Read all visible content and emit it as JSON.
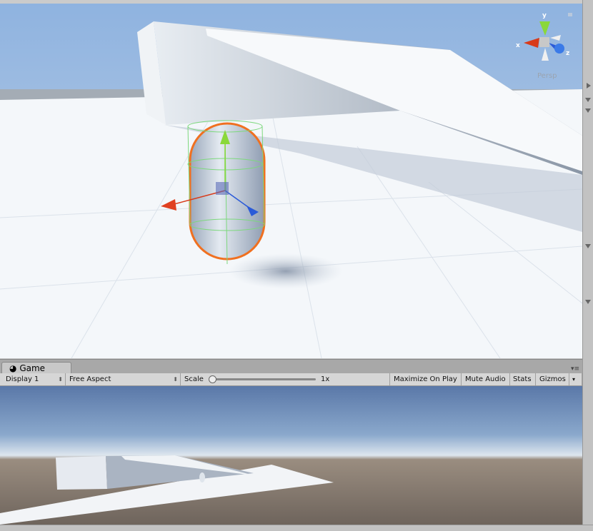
{
  "scene": {
    "view_mode": "Persp",
    "gizmo_axes": {
      "x": "x",
      "y": "y",
      "z": "z"
    },
    "colors": {
      "selection_outline": "#f07020",
      "x_axis": "#d83a1a",
      "y_axis": "#8ad83a",
      "z_axis": "#2a5ad8"
    }
  },
  "game": {
    "tab_label": "Game",
    "tab_icon": "pacman-icon",
    "display": "Display 1",
    "aspect": "Free Aspect",
    "scale_label": "Scale",
    "scale_value": "1x",
    "scale_fraction": 0,
    "maximize_on_play": "Maximize On Play",
    "mute_audio": "Mute Audio",
    "stats": "Stats",
    "gizmos": "Gizmos"
  }
}
